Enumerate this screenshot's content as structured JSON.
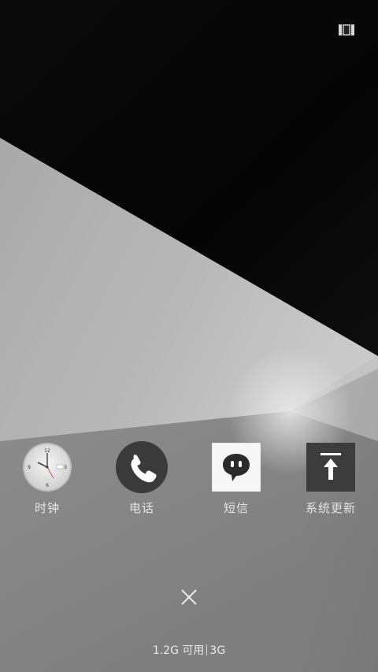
{
  "recent_panel": {
    "toggle_icon": "view-toggle-icon",
    "apps": [
      {
        "label": "时钟",
        "icon": "clock-icon"
      },
      {
        "label": "电话",
        "icon": "phone-icon"
      },
      {
        "label": "短信",
        "icon": "message-icon"
      },
      {
        "label": "系统更新",
        "icon": "system-update-icon"
      }
    ],
    "clock_face": {
      "n12": "12",
      "n3": "3",
      "n6": "6",
      "n9": "9"
    },
    "close_icon": "close-icon",
    "memory": {
      "available": "1.2G 可用",
      "total": "3G"
    }
  }
}
